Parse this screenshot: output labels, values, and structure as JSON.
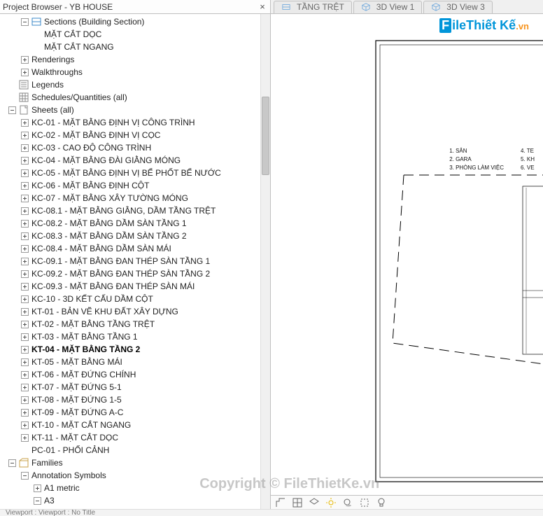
{
  "panel": {
    "title": "Project Browser - YB HOUSE"
  },
  "tabs": [
    {
      "label": "TẦNG TRỆT"
    },
    {
      "label": "3D View 1"
    },
    {
      "label": "3D View 3"
    }
  ],
  "logo": {
    "prefix": "F",
    "mid": "ileThiết Kế",
    "suffix": ".vn"
  },
  "tree": [
    {
      "depth": 1,
      "exp": "minus",
      "icon": "section",
      "label": "Sections (Building Section)"
    },
    {
      "depth": 2,
      "exp": "",
      "icon": "",
      "label": "MẶT CẮT DỌC"
    },
    {
      "depth": 2,
      "exp": "",
      "icon": "",
      "label": "MẶT CẮT NGANG"
    },
    {
      "depth": 1,
      "exp": "plus",
      "icon": "",
      "label": "Renderings"
    },
    {
      "depth": 1,
      "exp": "plus",
      "icon": "",
      "label": "Walkthroughs"
    },
    {
      "depth": 0,
      "exp": "",
      "icon": "legend",
      "label": "Legends"
    },
    {
      "depth": 0,
      "exp": "",
      "icon": "schedule",
      "label": "Schedules/Quantities (all)"
    },
    {
      "depth": 0,
      "exp": "minus",
      "icon": "sheet",
      "label": "Sheets (all)"
    },
    {
      "depth": 1,
      "exp": "plus",
      "icon": "",
      "label": "KC-01 - MẶT BẰNG ĐỊNH VỊ CÔNG TRÌNH"
    },
    {
      "depth": 1,
      "exp": "plus",
      "icon": "",
      "label": "KC-02 - MẶT BẰNG ĐỊNH VỊ CỌC"
    },
    {
      "depth": 1,
      "exp": "plus",
      "icon": "",
      "label": "KC-03 - CAO ĐỘ CÔNG TRÌNH"
    },
    {
      "depth": 1,
      "exp": "plus",
      "icon": "",
      "label": "KC-04 - MẶT BẰNG ĐÀI GIẰNG MÓNG"
    },
    {
      "depth": 1,
      "exp": "plus",
      "icon": "",
      "label": "KC-05 - MẶT BẰNG ĐỊNH VỊ BỂ PHỐT BỂ NƯỚC"
    },
    {
      "depth": 1,
      "exp": "plus",
      "icon": "",
      "label": "KC-06 - MẶT BẰNG ĐỊNH CỘT"
    },
    {
      "depth": 1,
      "exp": "plus",
      "icon": "",
      "label": "KC-07 - MẶT BẰNG XÂY TƯỜNG MÓNG"
    },
    {
      "depth": 1,
      "exp": "plus",
      "icon": "",
      "label": "KC-08.1 - MẶT BẰNG GIẰNG, DẦM TẦNG TRỆT"
    },
    {
      "depth": 1,
      "exp": "plus",
      "icon": "",
      "label": "KC-08.2 - MẶT BẰNG DẦM SÀN TẦNG 1"
    },
    {
      "depth": 1,
      "exp": "plus",
      "icon": "",
      "label": "KC-08.3 - MẶT BẰNG DẦM SÀN TẦNG 2"
    },
    {
      "depth": 1,
      "exp": "plus",
      "icon": "",
      "label": "KC-08.4 - MẶT BẰNG DẦM SÀN MÁI"
    },
    {
      "depth": 1,
      "exp": "plus",
      "icon": "",
      "label": "KC-09.1 - MẶT BẰNG ĐAN THÉP SÀN TẦNG 1"
    },
    {
      "depth": 1,
      "exp": "plus",
      "icon": "",
      "label": "KC-09.2 - MẶT BẰNG ĐAN THÉP SÀN TẦNG 2"
    },
    {
      "depth": 1,
      "exp": "plus",
      "icon": "",
      "label": "KC-09.3 - MẶT BẰNG ĐAN THÉP SÀN MÁI"
    },
    {
      "depth": 1,
      "exp": "plus",
      "icon": "",
      "label": "KC-10 - 3D KẾT CẤU DẦM CỘT"
    },
    {
      "depth": 1,
      "exp": "plus",
      "icon": "",
      "label": "KT-01 - BẢN VẼ KHU ĐẤT XÂY DỰNG"
    },
    {
      "depth": 1,
      "exp": "plus",
      "icon": "",
      "label": "KT-02 - MẶT BẰNG TẦNG TRỆT"
    },
    {
      "depth": 1,
      "exp": "plus",
      "icon": "",
      "label": "KT-03 - MẶT BẰNG TẦNG 1"
    },
    {
      "depth": 1,
      "exp": "plus",
      "icon": "",
      "label": "KT-04 - MẶT BẰNG TẦNG 2",
      "selected": true
    },
    {
      "depth": 1,
      "exp": "plus",
      "icon": "",
      "label": "KT-05 - MẶT BẰNG MÁI"
    },
    {
      "depth": 1,
      "exp": "plus",
      "icon": "",
      "label": "KT-06 - MẶT ĐỨNG CHÍNH"
    },
    {
      "depth": 1,
      "exp": "plus",
      "icon": "",
      "label": "KT-07 - MẶT ĐỨNG 5-1"
    },
    {
      "depth": 1,
      "exp": "plus",
      "icon": "",
      "label": "KT-08 - MẶT ĐỨNG 1-5"
    },
    {
      "depth": 1,
      "exp": "plus",
      "icon": "",
      "label": "KT-09 - MẶT ĐỨNG A-C"
    },
    {
      "depth": 1,
      "exp": "plus",
      "icon": "",
      "label": "KT-10 - MẶT CẮT NGANG"
    },
    {
      "depth": 1,
      "exp": "plus",
      "icon": "",
      "label": "KT-11 - MẶT CẮT DỌC"
    },
    {
      "depth": 1,
      "exp": "",
      "icon": "",
      "label": "PC-01 - PHỐI CẢNH"
    },
    {
      "depth": 0,
      "exp": "minus",
      "icon": "family",
      "label": "Families"
    },
    {
      "depth": 1,
      "exp": "minus",
      "icon": "",
      "label": "Annotation Symbols"
    },
    {
      "depth": 2,
      "exp": "plus",
      "icon": "",
      "label": "A1 metric"
    },
    {
      "depth": 2,
      "exp": "minus",
      "icon": "",
      "label": "A3"
    }
  ],
  "drawing_notes": {
    "l1": "1. SÂN",
    "l2": "2. GARA",
    "l3": "3. PHÒNG LÀM VIỆC",
    "r1": "4. TE",
    "r2": "5. KH",
    "r3": "6. VE"
  },
  "status": {
    "zoom_value": ""
  },
  "bottom": {
    "text": "Viewport : Viewport : No Title"
  },
  "watermark": "Copyright © FileThietKe.vn"
}
